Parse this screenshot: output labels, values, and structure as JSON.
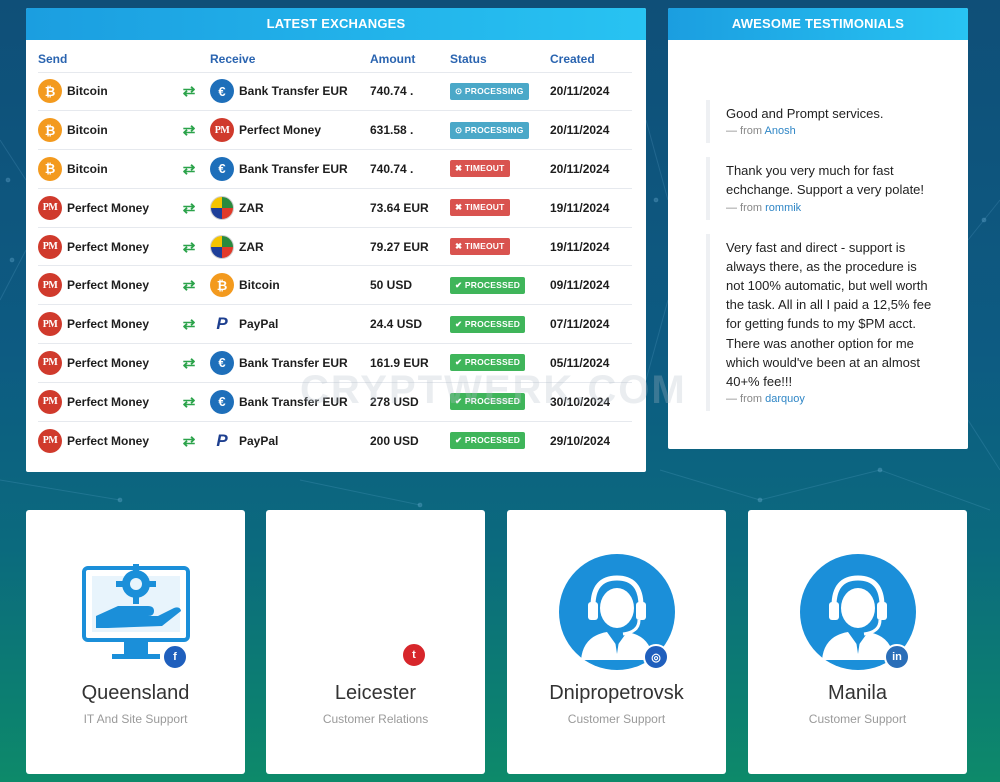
{
  "exchanges": {
    "title": "LATEST EXCHANGES",
    "headers": {
      "send": "Send",
      "receive": "Receive",
      "amount": "Amount",
      "status": "Status",
      "created": "Created"
    },
    "rows": [
      {
        "send": "Bitcoin",
        "send_icon": "bitcoin-icon",
        "receive": "Bank Transfer EUR",
        "receive_icon": "euro-icon",
        "amount": "740.74 .",
        "status": "PROCESSING",
        "created": "20/11/2024"
      },
      {
        "send": "Bitcoin",
        "send_icon": "bitcoin-icon",
        "receive": "Perfect Money",
        "receive_icon": "perfect-money-icon",
        "amount": "631.58 .",
        "status": "PROCESSING",
        "created": "20/11/2024"
      },
      {
        "send": "Bitcoin",
        "send_icon": "bitcoin-icon",
        "receive": "Bank Transfer EUR",
        "receive_icon": "euro-icon",
        "amount": "740.74 .",
        "status": "TIMEOUT",
        "created": "20/11/2024"
      },
      {
        "send": "Perfect Money",
        "send_icon": "perfect-money-icon",
        "receive": "ZAR",
        "receive_icon": "south-africa-flag-icon",
        "amount": "73.64 EUR",
        "status": "TIMEOUT",
        "created": "19/11/2024"
      },
      {
        "send": "Perfect Money",
        "send_icon": "perfect-money-icon",
        "receive": "ZAR",
        "receive_icon": "south-africa-flag-icon",
        "amount": "79.27 EUR",
        "status": "TIMEOUT",
        "created": "19/11/2024"
      },
      {
        "send": "Perfect Money",
        "send_icon": "perfect-money-icon",
        "receive": "Bitcoin",
        "receive_icon": "bitcoin-icon",
        "amount": "50 USD",
        "status": "PROCESSED",
        "created": "09/11/2024"
      },
      {
        "send": "Perfect Money",
        "send_icon": "perfect-money-icon",
        "receive": "PayPal",
        "receive_icon": "paypal-icon",
        "amount": "24.4 USD",
        "status": "PROCESSED",
        "created": "07/11/2024"
      },
      {
        "send": "Perfect Money",
        "send_icon": "perfect-money-icon",
        "receive": "Bank Transfer EUR",
        "receive_icon": "euro-icon",
        "amount": "161.9 EUR",
        "status": "PROCESSED",
        "created": "05/11/2024"
      },
      {
        "send": "Perfect Money",
        "send_icon": "perfect-money-icon",
        "receive": "Bank Transfer EUR",
        "receive_icon": "euro-icon",
        "amount": "278 USD",
        "status": "PROCESSED",
        "created": "30/10/2024"
      },
      {
        "send": "Perfect Money",
        "send_icon": "perfect-money-icon",
        "receive": "PayPal",
        "receive_icon": "paypal-icon",
        "amount": "200 USD",
        "status": "PROCESSED",
        "created": "29/10/2024"
      }
    ]
  },
  "testimonials": {
    "title": "AWESOME TESTIMONIALS",
    "items": [
      {
        "text": "Good and Prompt services.",
        "from_prefix": "— from",
        "author": "Anosh"
      },
      {
        "text": "Thank you very much for fast echchange. Support a very polate!",
        "from_prefix": "— from",
        "author": "rommik"
      },
      {
        "text": "Very fast and direct - support is always there, as the procedure is not 100% automatic, but well worth the task. All in all I paid a 12,5% fee for getting funds to my $PM acct. There was another option for me which would've been at an almost 40+% fee!!!",
        "from_prefix": "— from",
        "author": "darquoy"
      }
    ]
  },
  "team": [
    {
      "name": "Queensland",
      "role": "IT And Site Support",
      "social": "facebook-icon",
      "social_glyph": "f",
      "avatar": "computer-gear-hand-icon"
    },
    {
      "name": "Leicester",
      "role": "Customer Relations",
      "social": "twitter-icon",
      "social_glyph": "t",
      "avatar": ""
    },
    {
      "name": "Dnipropetrovsk",
      "role": "Customer Support",
      "social": "instagram-icon",
      "social_glyph": "◎",
      "avatar": "support-agent-icon"
    },
    {
      "name": "Manila",
      "role": "Customer Support",
      "social": "linkedin-icon",
      "social_glyph": "in",
      "avatar": "support-agent-icon"
    }
  ],
  "watermark": "CRYPTWERK.COM",
  "colors": {
    "header_gradient_start": "#1b9ee0",
    "header_gradient_end": "#28c3f2",
    "column_header": "#2a64b0",
    "processing": "#4aa8c8",
    "timeout": "#d9534f",
    "processed": "#3fb55a",
    "author_link": "#2f86c6",
    "avatar_blue": "#1b8fd9"
  }
}
